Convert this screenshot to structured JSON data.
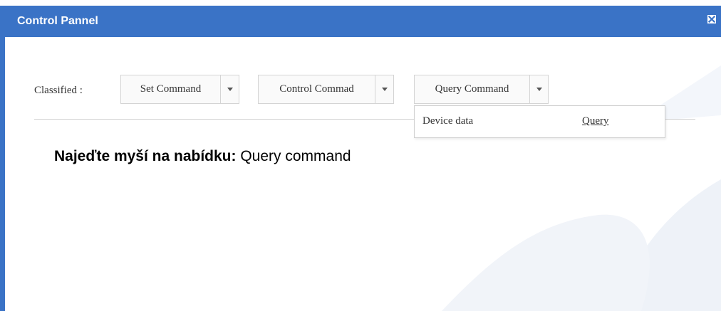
{
  "window": {
    "title": "Control Pannel"
  },
  "filters": {
    "classified_label": "Classified :",
    "commands": [
      {
        "label": "Set Command"
      },
      {
        "label": "Control Commad"
      },
      {
        "label": "Query Command"
      }
    ]
  },
  "dropdown": {
    "item_label": "Device data",
    "action_link": "Query"
  },
  "instruction": {
    "bold": "Najeďte myší na nabídku:",
    "text": " Query command"
  },
  "colors": {
    "titlebar": "#3a73c6",
    "watermark": "#eef2f8"
  }
}
